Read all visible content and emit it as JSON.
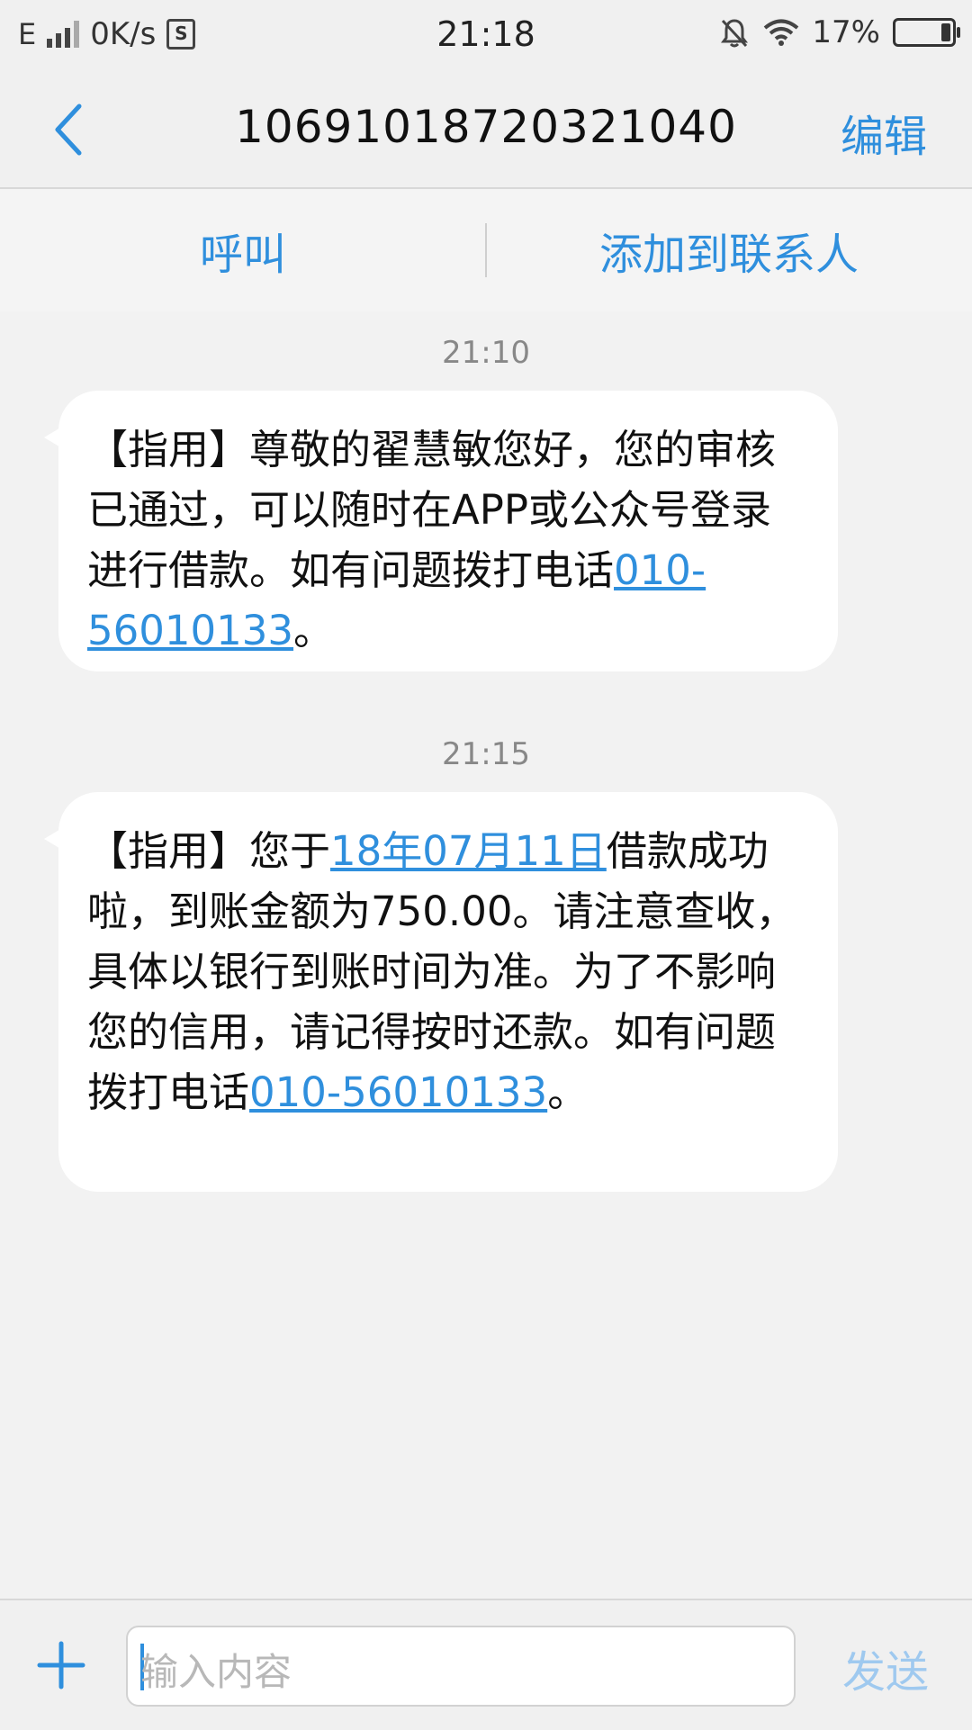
{
  "status_bar": {
    "network_type": "E",
    "speed": "0K/s",
    "speed_badge": "S",
    "time": "21:18",
    "battery": "17%",
    "battery_level": 0.17,
    "icons": [
      "signal-icon",
      "mute-bell-icon",
      "wifi-icon",
      "battery-icon"
    ]
  },
  "header": {
    "title": "10691018720321040",
    "edit_label": "编辑"
  },
  "actions": {
    "call_label": "呼叫",
    "add_contact_label": "添加到联系人"
  },
  "messages": [
    {
      "time": "21:10",
      "text_before": "【指用】尊敬的翟慧敏您好，您的审核已通过，可以随时在APP或公众号登录进行借款。如有问题拨打电话",
      "link": "010-56010133",
      "text_after": "。"
    },
    {
      "time": "21:15",
      "text_1": "【指用】您于",
      "date_link": "18年07月11日",
      "text_2": "借款成功啦，到账金额为750.00。请注意查收，具体以银行到账时间为准。为了不影响您的信用，请记得按时还款。如有问题拨打电话",
      "phone_link": "010-56010133",
      "text_3": "。"
    }
  ],
  "composer": {
    "placeholder": "输入内容",
    "send_label": "发送"
  },
  "colors": {
    "accent": "#2f8fdd",
    "send_disabled": "#9fc9ef",
    "background": "#f2f2f2",
    "bubble": "#ffffff"
  }
}
